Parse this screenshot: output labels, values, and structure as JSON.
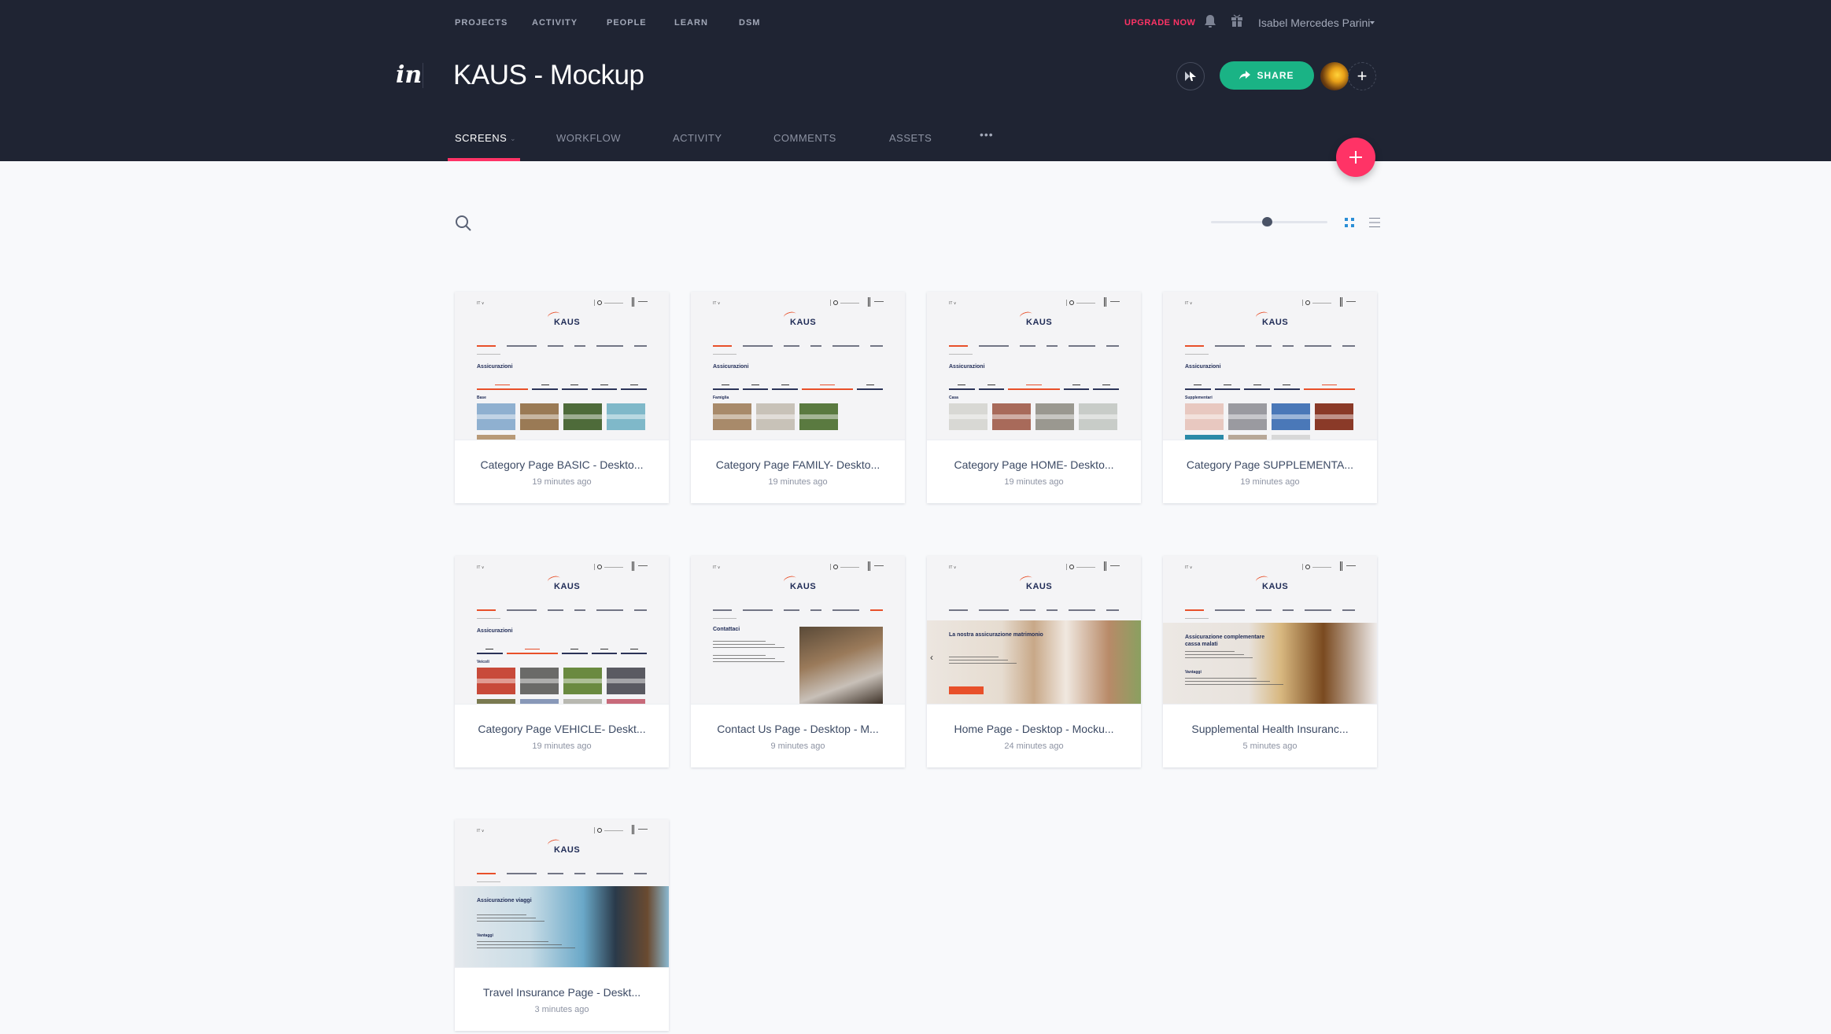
{
  "topnav": {
    "items": [
      "PROJECTS",
      "ACTIVITY",
      "PEOPLE",
      "LEARN",
      "DSM"
    ],
    "upgrade_label": "UPGRADE NOW",
    "user_name": "Isabel Mercedes Parini",
    "icons": {
      "notifications": "bell-icon",
      "whats_new": "gift-icon"
    }
  },
  "project": {
    "logo": "in",
    "title": "KAUS - Mockup"
  },
  "actions": {
    "share_label": "SHARE",
    "add_collaborator": "+",
    "fab": "+"
  },
  "tabs": {
    "items": [
      {
        "label": "SCREENS",
        "active": true,
        "has_caret": true
      },
      {
        "label": "WORKFLOW",
        "active": false
      },
      {
        "label": "ACTIVITY",
        "active": false
      },
      {
        "label": "COMMENTS",
        "active": false
      },
      {
        "label": "ASSETS",
        "active": false
      }
    ],
    "more": "•••"
  },
  "toolbar": {
    "zoom_slider_fraction": 0.48,
    "view_mode": "grid"
  },
  "colors": {
    "header_bg": "#1f2433",
    "accent_pink": "#ff3366",
    "share_green": "#1ab385",
    "grid_active_blue": "#2b8fd6",
    "kaus_orange": "#e8502a",
    "kaus_navy": "#1f2b56"
  },
  "screens": [
    {
      "title": "Category Page BASIC - Deskto...",
      "time": "19 minutes ago",
      "kind": "category",
      "heading": "Assicurazioni",
      "sub": "Base",
      "active_tab": 0,
      "tiles": [
        "#8fb0d0",
        "#9a7a55",
        "#4e6b3a",
        "#7fb8c9",
        "#b89a78"
      ]
    },
    {
      "title": "Category Page FAMILY- Deskto...",
      "time": "19 minutes ago",
      "kind": "category",
      "heading": "Assicurazioni",
      "sub": "Famiglia",
      "active_tab": 3,
      "tiles": [
        "#a88a6a",
        "#c8c2b8",
        "#5a7a40"
      ]
    },
    {
      "title": "Category Page HOME- Deskto...",
      "time": "19 minutes ago",
      "kind": "category",
      "heading": "Assicurazioni",
      "sub": "Casa",
      "active_tab": 2,
      "tiles": [
        "#d8d8d4",
        "#a86a5a",
        "#9a9890",
        "#c8ccc8"
      ]
    },
    {
      "title": "Category Page SUPPLEMENTA...",
      "time": "19 minutes ago",
      "kind": "category",
      "heading": "Assicurazioni",
      "sub": "Supplementari",
      "active_tab": 4,
      "tiles": [
        "#e8c8c0",
        "#9a9aa0",
        "#4a78b8",
        "#8a3a28",
        "#2a8aa8",
        "#b8a898",
        "#d8d8d8"
      ]
    },
    {
      "title": "Category Page VEHICLE- Deskt...",
      "time": "19 minutes ago",
      "kind": "category",
      "heading": "Assicurazioni",
      "sub": "Veicoli",
      "active_tab": 1,
      "tiles": [
        "#c84a3a",
        "#6a6a68",
        "#6a8a40",
        "#5a5a62",
        "#7a7a50",
        "#8898b8",
        "#b8b8b0",
        "#c86a7a"
      ]
    },
    {
      "title": "Contact Us Page - Desktop - M...",
      "time": "9 minutes ago",
      "kind": "contact",
      "heading": "Contattaci"
    },
    {
      "title": "Home Page - Desktop - Mocku...",
      "time": "24 minutes ago",
      "kind": "home",
      "heading": "La nostra assicurazione matrimonio"
    },
    {
      "title": "Supplemental Health Insuranc...",
      "time": "5 minutes ago",
      "kind": "supp",
      "heading": "Assicurazione complementare cassa malati"
    },
    {
      "title": "Travel Insurance Page - Deskt...",
      "time": "3 minutes ago",
      "kind": "travel",
      "heading": "Assicurazione viaggi"
    }
  ],
  "mini_site": {
    "logo": "KAUS",
    "category_tabs": [
      "Base",
      "Veicoli",
      "Casa",
      "Famiglia",
      "Supplementari"
    ]
  }
}
